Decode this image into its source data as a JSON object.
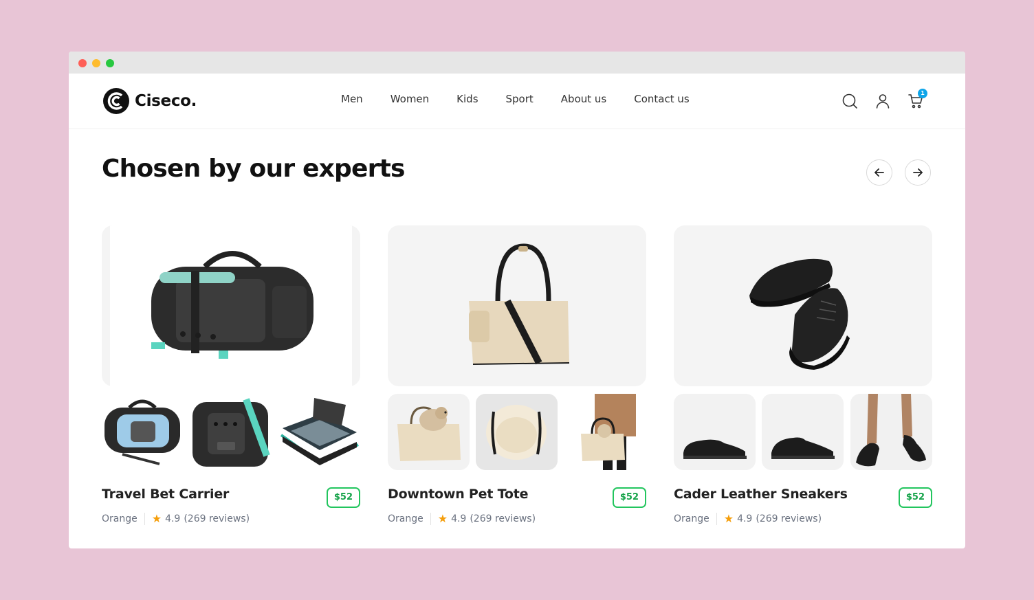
{
  "brand": {
    "name": "Ciseco."
  },
  "nav": {
    "items": [
      "Men",
      "Women",
      "Kids",
      "Sport",
      "About us",
      "Contact us"
    ]
  },
  "header": {
    "cart_count": "1",
    "icons": [
      "search-icon",
      "user-icon",
      "cart-icon"
    ]
  },
  "section": {
    "title": "Chosen by our experts",
    "prev_icon": "arrow-left-icon",
    "next_icon": "arrow-right-icon"
  },
  "products": [
    {
      "name": "Travel Bet Carrier",
      "price": "$52",
      "color": "Orange",
      "rating": "4.9",
      "reviews": "(269 reviews)"
    },
    {
      "name": "Downtown Pet Tote",
      "price": "$52",
      "color": "Orange",
      "rating": "4.9",
      "reviews": "(269 reviews)"
    },
    {
      "name": "Cader Leather Sneakers",
      "price": "$52",
      "color": "Orange",
      "rating": "4.9",
      "reviews": "(269 reviews)"
    }
  ],
  "colors": {
    "background": "#e8c5d6",
    "price_green": "#22c55e",
    "star": "#f59e0b",
    "badge": "#0ea5e9"
  }
}
